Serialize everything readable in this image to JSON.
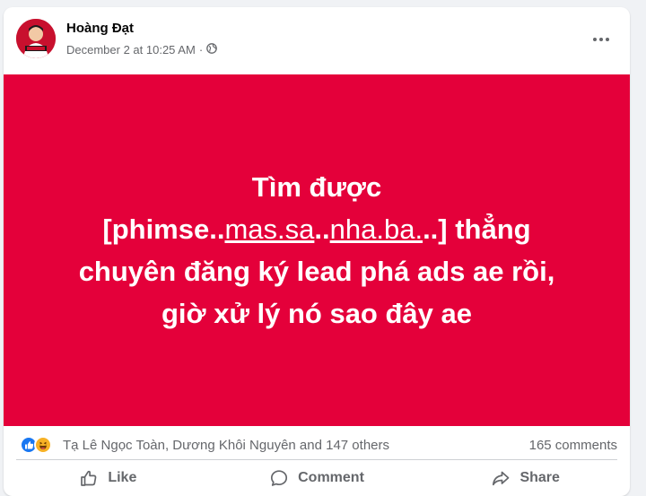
{
  "post": {
    "author": "Hoàng Đạt",
    "timestamp": "December 2 at 10:25 AM",
    "audience_icon": "globe-icon",
    "text": {
      "line1": "Tìm được",
      "bracket_open": "[phimse..",
      "link1": "mas.sa",
      "mid": "..",
      "link2": "nha.ba.",
      "bracket_close": "..] thẳng",
      "line3": "chuyên đăng ký lead phá ads ae rồi,",
      "line4": "giờ xử lý nó sao đây ae"
    },
    "background_color": "#e4003a"
  },
  "reactions": {
    "icons": [
      "like-icon",
      "haha-icon"
    ],
    "reacted_by": "Tạ Lê Ngọc Toàn, Dương Khôi Nguyên and 147 others",
    "comments": "165 comments"
  },
  "actions": {
    "like": "Like",
    "comment": "Comment",
    "share": "Share"
  }
}
